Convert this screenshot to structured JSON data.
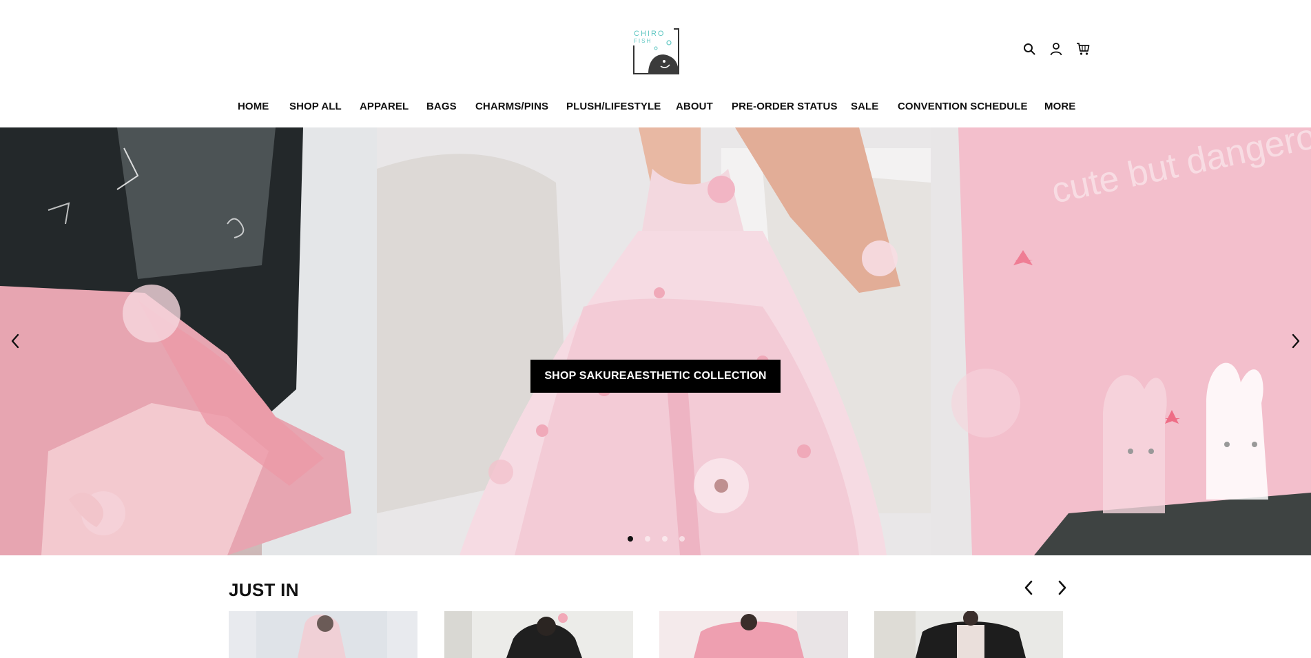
{
  "brand": {
    "logo_line1": "CHIRO",
    "logo_line2": "FISH"
  },
  "header": {
    "icons": [
      "search-icon",
      "account-icon",
      "cart-icon"
    ]
  },
  "nav": {
    "items": [
      {
        "label": "HOME"
      },
      {
        "label": "SHOP ALL"
      },
      {
        "label": "APPAREL"
      },
      {
        "label": "BAGS"
      },
      {
        "label": "CHARMS/PINS"
      },
      {
        "label": "PLUSH/LIFESTYLE"
      },
      {
        "label": "ABOUT"
      },
      {
        "label": "PRE-ORDER STATUS"
      },
      {
        "label": "SALE"
      },
      {
        "label": "CONVENTION SCHEDULE"
      },
      {
        "label": "MORE"
      }
    ]
  },
  "hero": {
    "cta_label": "SHOP SAKUREAESTHETIC COLLECTION",
    "image_text": "cute but dangerous",
    "slide_count": 4,
    "active_slide": 1
  },
  "just_in": {
    "title": "JUST IN"
  },
  "colors": {
    "accent": "#000000",
    "logo_teal": "#5fc7c2",
    "hero_pink": "#f2c7d2"
  }
}
